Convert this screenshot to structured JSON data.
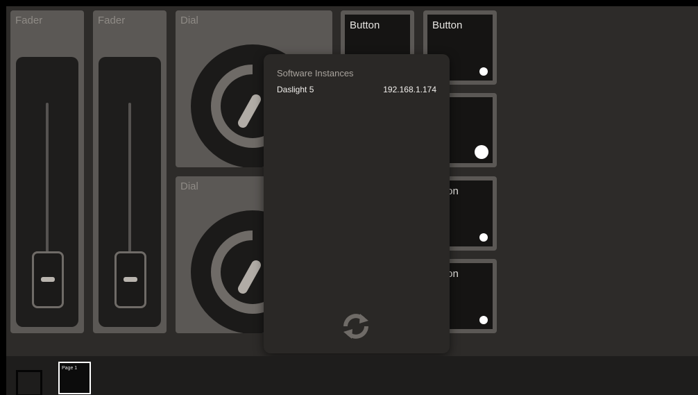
{
  "faders": [
    {
      "label": "Fader",
      "level": 0.0
    },
    {
      "label": "Fader",
      "level": 0.0
    }
  ],
  "dials": [
    {
      "label": "Dial"
    },
    {
      "label": "Dial"
    }
  ],
  "buttons": [
    {
      "label": "Button"
    },
    {
      "label": "Button"
    },
    {
      "label": ""
    },
    {
      "label": "ton"
    },
    {
      "label": "ton"
    }
  ],
  "popup": {
    "title": "Software Instances",
    "instances": [
      {
        "name": "Daslight 5",
        "ip": "192.168.1.174"
      }
    ],
    "refresh_icon": "refresh-icon"
  },
  "bottom_bar": {
    "page_selector_icon": "square-icon",
    "pages": [
      {
        "label": "Page 1"
      }
    ]
  },
  "colors": {
    "background": "#2d2b29",
    "panel": "#5b5855",
    "control_dark": "#1e1d1c",
    "popup": "#2a2826",
    "led": "#ffffff"
  }
}
